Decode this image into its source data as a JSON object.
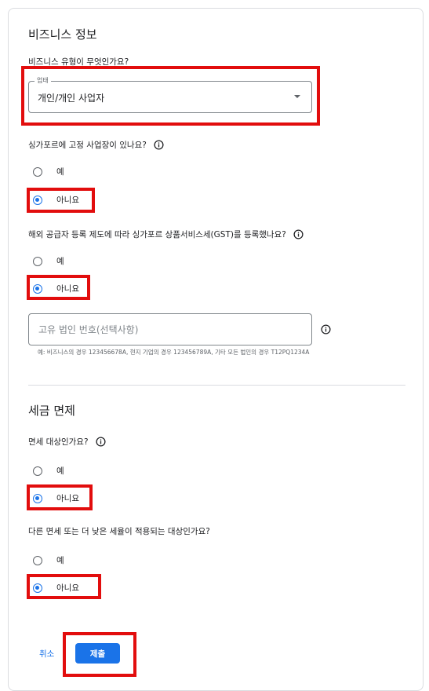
{
  "business_info": {
    "title": "비즈니스 정보",
    "business_type": {
      "question": "비즈니스 유형이 무엇인가요?",
      "field_label": "업태",
      "selected_value": "개인/개인 사업자"
    },
    "fixed_establishment": {
      "question": "싱가포르에 고정 사업장이 있나요?",
      "options": [
        {
          "label": "예",
          "checked": false
        },
        {
          "label": "아니요",
          "checked": true
        }
      ]
    },
    "gst_registration": {
      "question": "해외 공급자 등록 제도에 따라 싱가포르 상품서비스세(GST)를 등록했나요?",
      "options": [
        {
          "label": "예",
          "checked": false
        },
        {
          "label": "아니요",
          "checked": true
        }
      ]
    },
    "entity_number": {
      "placeholder": "고유 법인 번호(선택사항)",
      "hint": "예: 비즈니스의 경우 123456678A, 현지 기업의 경우 123456789A, 기타 모든 법인의 경우 T12PQ1234A"
    }
  },
  "tax_exemption": {
    "title": "세금 면제",
    "exempt": {
      "question": "면세 대상인가요?",
      "options": [
        {
          "label": "예",
          "checked": false
        },
        {
          "label": "아니요",
          "checked": true
        }
      ]
    },
    "reduced_rate": {
      "question": "다른 면세 또는 더 낮은 세율이 적용되는 대상인가요?",
      "options": [
        {
          "label": "예",
          "checked": false
        },
        {
          "label": "아니요",
          "checked": true
        }
      ]
    }
  },
  "actions": {
    "cancel_label": "취소",
    "submit_label": "제출"
  },
  "colors": {
    "accent": "#1a73e8",
    "highlight": "#e20d0d",
    "border": "#dadce0"
  },
  "icons": [
    "info-icon",
    "dropdown-caret-icon"
  ]
}
